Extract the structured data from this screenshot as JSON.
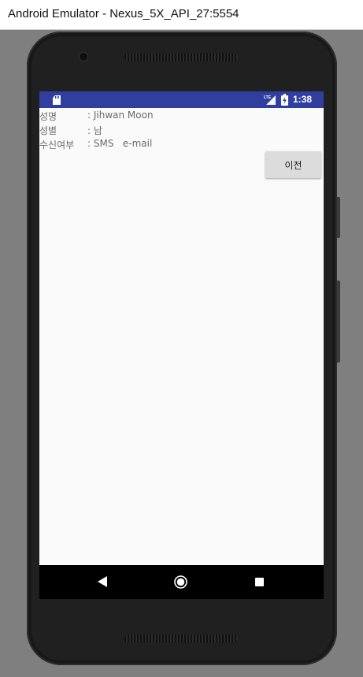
{
  "window": {
    "title": "Android Emulator - Nexus_5X_API_27:5554"
  },
  "status_bar": {
    "time": "1:38",
    "network_label": "LTE",
    "color": "#303f9f",
    "icons": [
      "sd-card-icon",
      "lte-signal-icon",
      "battery-charging-icon"
    ]
  },
  "info": {
    "rows": [
      {
        "label": "성명",
        "value": ": Jihwan Moon"
      },
      {
        "label": "성별",
        "value": ": 남"
      },
      {
        "label": "수신여부",
        "value": ": SMS   e-mail"
      }
    ]
  },
  "buttons": {
    "previous": "이전"
  },
  "nav_bar": {
    "icons": [
      "back-icon",
      "home-icon",
      "recent-apps-icon"
    ]
  }
}
